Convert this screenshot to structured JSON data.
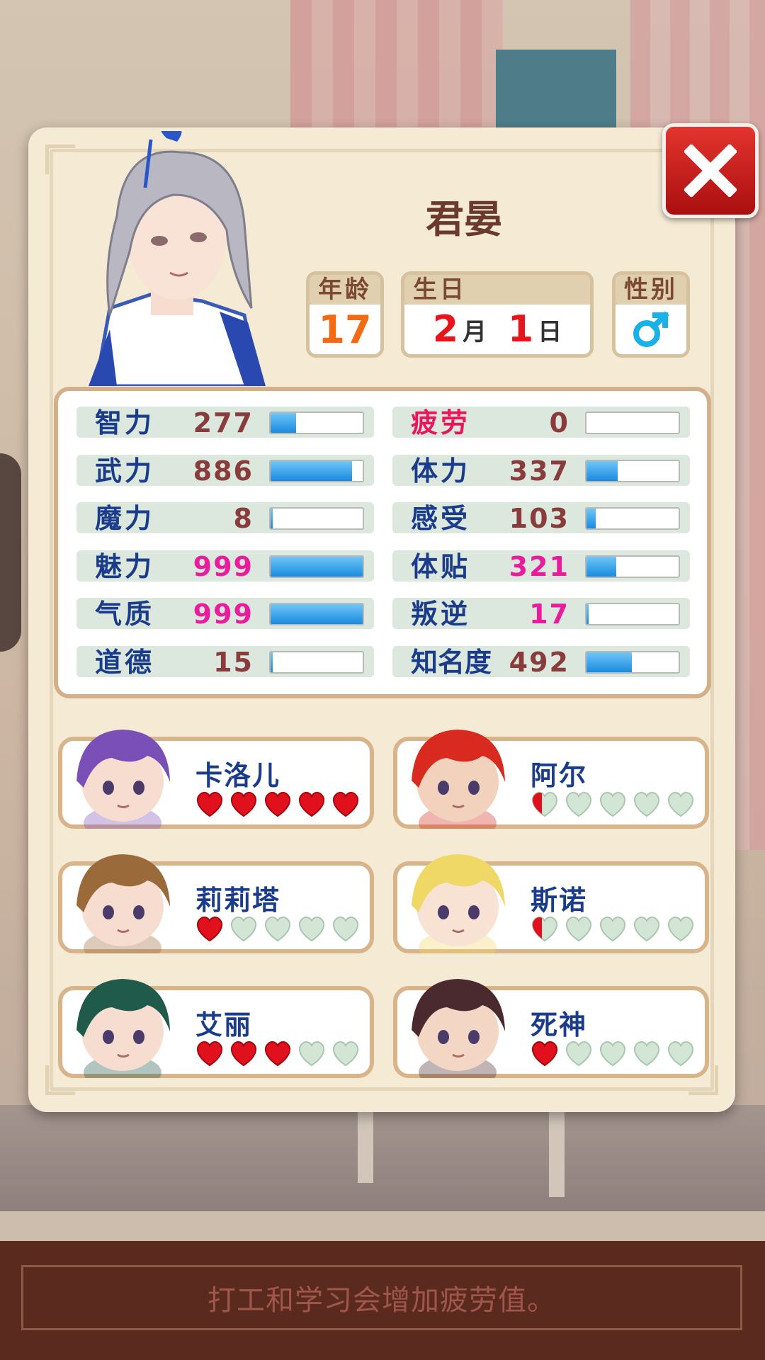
{
  "character": {
    "name": "君晏",
    "age_label": "年龄",
    "age": "17",
    "birthday_label": "生日",
    "birth_month": "2",
    "month_unit": "月",
    "birth_day": "1",
    "day_unit": "日",
    "gender_label": "性别",
    "gender_icon": "male-icon"
  },
  "stats_left": [
    {
      "label": "智力",
      "value": "277",
      "fraction": 0.277
    },
    {
      "label": "武力",
      "value": "886",
      "fraction": 0.886
    },
    {
      "label": "魔力",
      "value": "8",
      "fraction": 0.008
    },
    {
      "label": "魅力",
      "value": "999",
      "fraction": 0.999
    },
    {
      "label": "气质",
      "value": "999",
      "fraction": 0.999
    },
    {
      "label": "道德",
      "value": "15",
      "fraction": 0.015
    }
  ],
  "stats_right": [
    {
      "label": "疲劳",
      "value": "0",
      "fraction": 0.0
    },
    {
      "label": "体力",
      "value": "337",
      "fraction": 0.337
    },
    {
      "label": "感受",
      "value": "103",
      "fraction": 0.103
    },
    {
      "label": "体贴",
      "value": "321",
      "fraction": 0.321
    },
    {
      "label": "叛逆",
      "value": "17",
      "fraction": 0.017
    },
    {
      "label": "知名度",
      "value": "492",
      "fraction": 0.492
    }
  ],
  "companions": [
    {
      "name": "卡洛儿",
      "hearts": 5
    },
    {
      "name": "阿尔",
      "hearts": 0.5
    },
    {
      "name": "莉莉塔",
      "hearts": 1
    },
    {
      "name": "斯诺",
      "hearts": 0.5
    },
    {
      "name": "艾丽",
      "hearts": 3
    },
    {
      "name": "死神",
      "hearts": 1
    }
  ],
  "hint": "打工和学习会增加疲劳值。",
  "colors": {
    "stat_max": "#e81c9c",
    "stat_normal": "#8a3c3c",
    "bar_fill": "#1a8ae0",
    "heart_full": "#e0101c",
    "heart_empty": "#d3e6d6"
  }
}
